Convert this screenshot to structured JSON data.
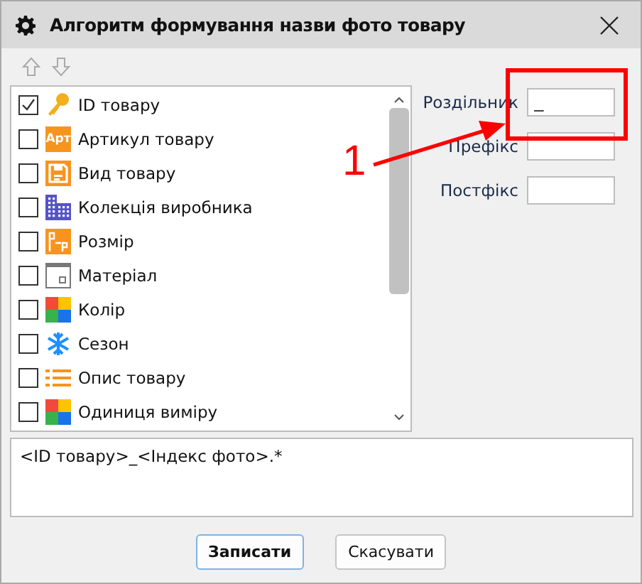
{
  "window": {
    "title": "Алгоритм формування назви фото товару"
  },
  "fields": [
    {
      "label": "Роздільник",
      "value": "_"
    },
    {
      "label": "Префікс"
    },
    {
      "label": "Постфікс"
    }
  ],
  "items": [
    {
      "label": "ID товару",
      "checked": true,
      "kind": "key"
    },
    {
      "label": "Артикул товару",
      "checked": false,
      "kind": "badge",
      "badge": "Арт"
    },
    {
      "label": "Вид товару",
      "checked": false,
      "kind": "form"
    },
    {
      "label": "Колекція виробника",
      "checked": false,
      "kind": "building"
    },
    {
      "label": "Розмір",
      "checked": false,
      "kind": "size"
    },
    {
      "label": "Матеріал",
      "checked": false,
      "kind": "window"
    },
    {
      "label": "Колір",
      "checked": false,
      "kind": "colors"
    },
    {
      "label": "Сезон",
      "checked": false,
      "kind": "snowflake"
    },
    {
      "label": "Опис товару",
      "checked": false,
      "kind": "list"
    },
    {
      "label": "Одиниця виміру",
      "checked": false,
      "kind": "colors"
    }
  ],
  "template": "<ID товару>_<Індекс фото>.*",
  "buttons": [
    {
      "label": "Записати",
      "default": true
    },
    {
      "label": "Скасувати",
      "default": false
    }
  ],
  "annotation": {
    "number": "1"
  }
}
